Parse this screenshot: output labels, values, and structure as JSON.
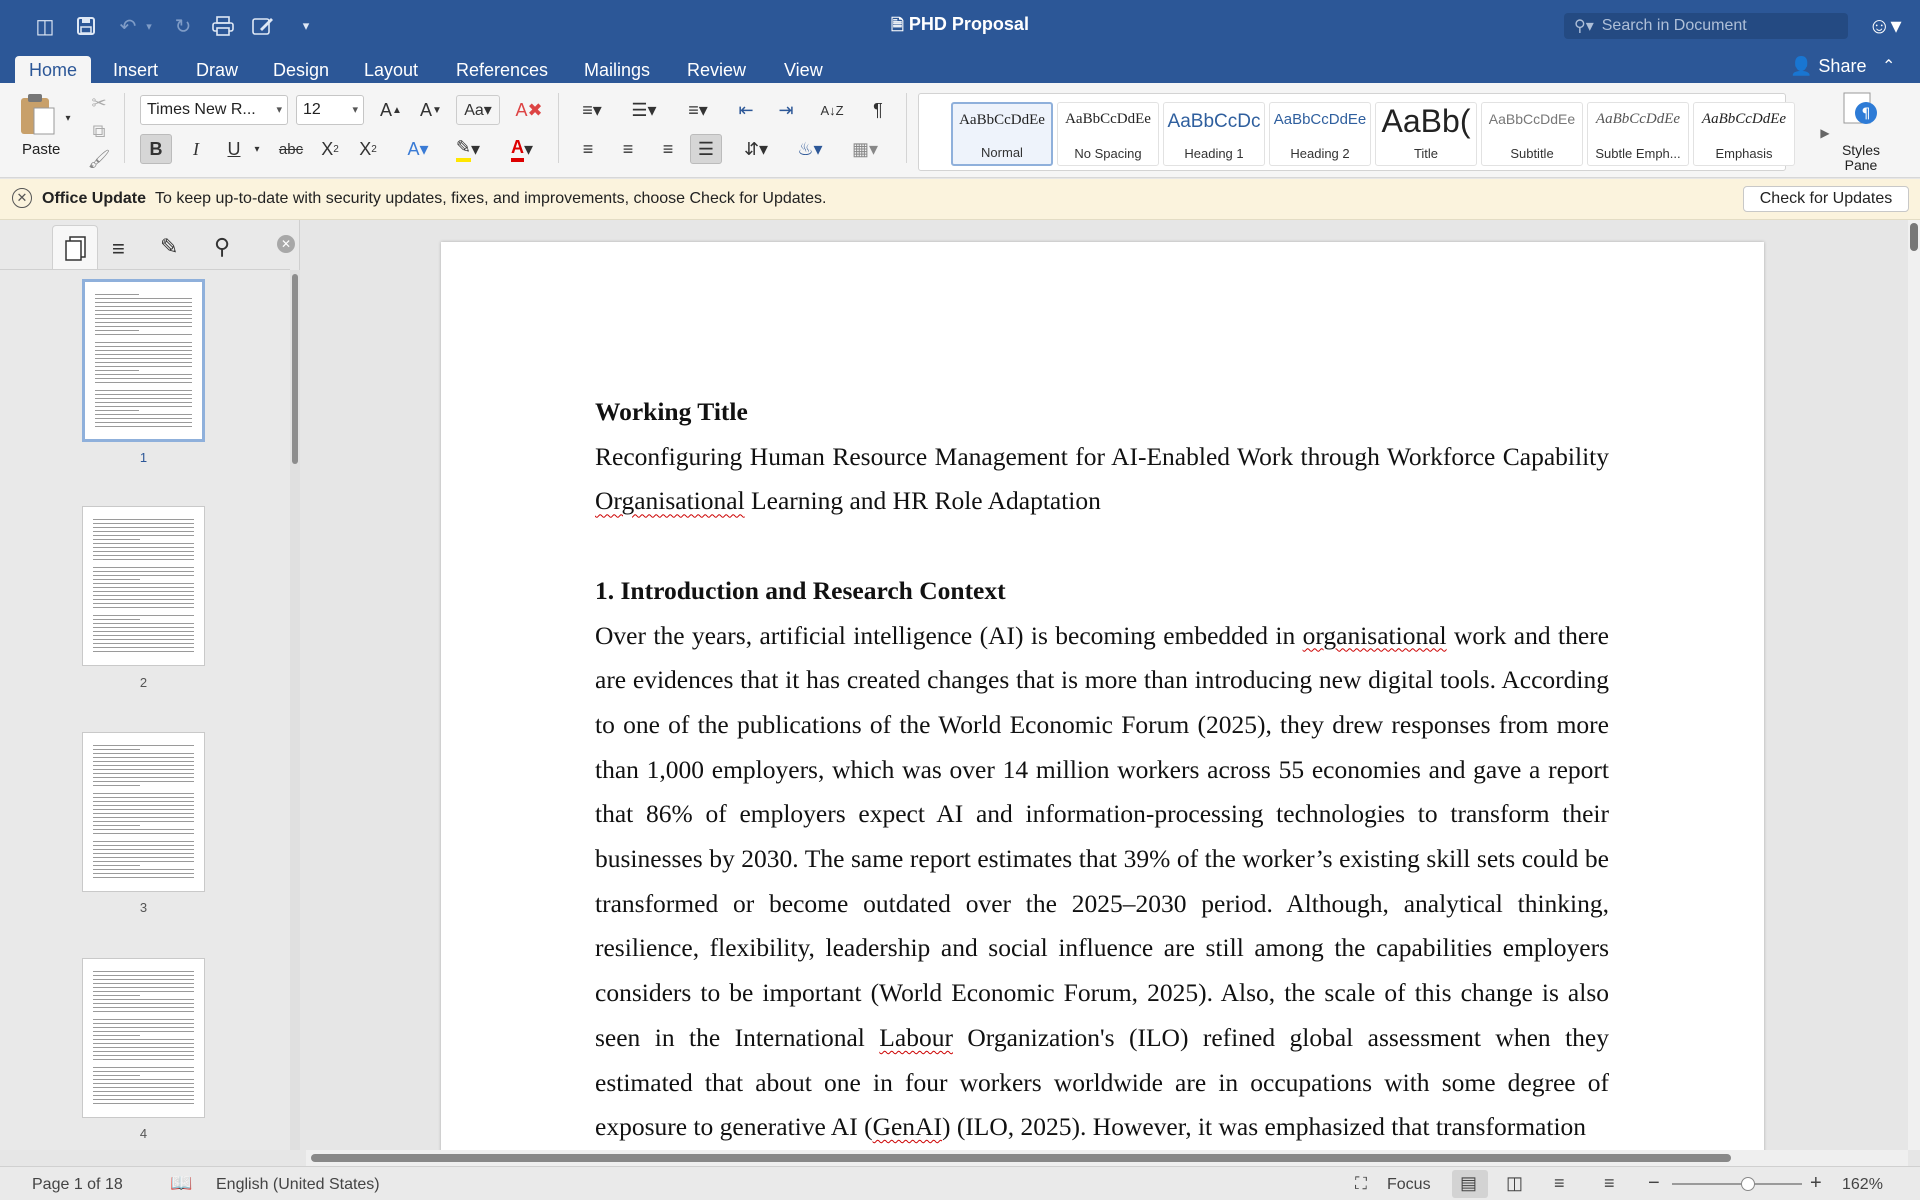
{
  "window": {
    "title": "PHD Proposal",
    "search_placeholder": "Search in Document"
  },
  "tabs": [
    "Home",
    "Insert",
    "Draw",
    "Design",
    "Layout",
    "References",
    "Mailings",
    "Review",
    "View"
  ],
  "share_label": "Share",
  "ribbon": {
    "paste_label": "Paste",
    "font_name": "Times New R...",
    "font_size": "12",
    "styles": [
      {
        "preview": "AaBbCcDdEe",
        "name": "Normal"
      },
      {
        "preview": "AaBbCcDdEe",
        "name": "No Spacing"
      },
      {
        "preview": "AaBbCcDc",
        "name": "Heading 1"
      },
      {
        "preview": "AaBbCcDdEe",
        "name": "Heading 2"
      },
      {
        "preview": "AaBb(",
        "name": "Title"
      },
      {
        "preview": "AaBbCcDdEe",
        "name": "Subtitle"
      },
      {
        "preview": "AaBbCcDdEe",
        "name": "Subtle Emph..."
      },
      {
        "preview": "AaBbCcDdEe",
        "name": "Emphasis"
      }
    ],
    "styles_pane_line1": "Styles",
    "styles_pane_line2": "Pane"
  },
  "message_bar": {
    "title": "Office Update",
    "text": "To keep up-to-date with security updates, fixes, and improvements, choose Check for Updates.",
    "button": "Check for Updates"
  },
  "thumbnails": [
    "1",
    "2",
    "3",
    "4"
  ],
  "document": {
    "working_title_heading": "Working Title",
    "title_a": "Reconfiguring Human Resource Management for AI-Enabled Work through Workforce Capability ",
    "title_sq": "Organisational",
    "title_b": " Learning and HR Role Adaptation",
    "section_heading": "1. Introduction and Research Context",
    "para_a": "Over the years, artificial intelligence (AI) is becoming embedded in ",
    "para_sq1": "organisational",
    "para_b": " work and there are evidences that it has created changes that is more than introducing new digital tools. According to one of the publications of the World Economic Forum (2025), they drew responses from more than 1,000 employers, which was over 14 million workers across 55 economies and gave a report that 86% of employers expect AI and information-processing technologies to transform their businesses by 2030. The same report estimates that 39% of the worker’s existing skill sets could be transformed or become outdated over the 2025–2030 period. Although, analytical thinking, resilience, flexibility, leadership and social influence are still among the capabilities employers considers to be important (World Economic Forum, 2025). Also, the scale of this change is also seen in the International ",
    "para_sq2": "Labour",
    "para_c": " Organization's (ILO) refined global assessment when they estimated that about one in four workers worldwide are in occupations with some degree of exposure to generative AI (",
    "para_sq3": "GenAI",
    "para_d": ") (ILO, 2025). However, it was emphasized that transformation"
  },
  "status": {
    "page": "Page 1 of 18",
    "language": "English (United States)",
    "focus": "Focus",
    "zoom": "162%"
  }
}
